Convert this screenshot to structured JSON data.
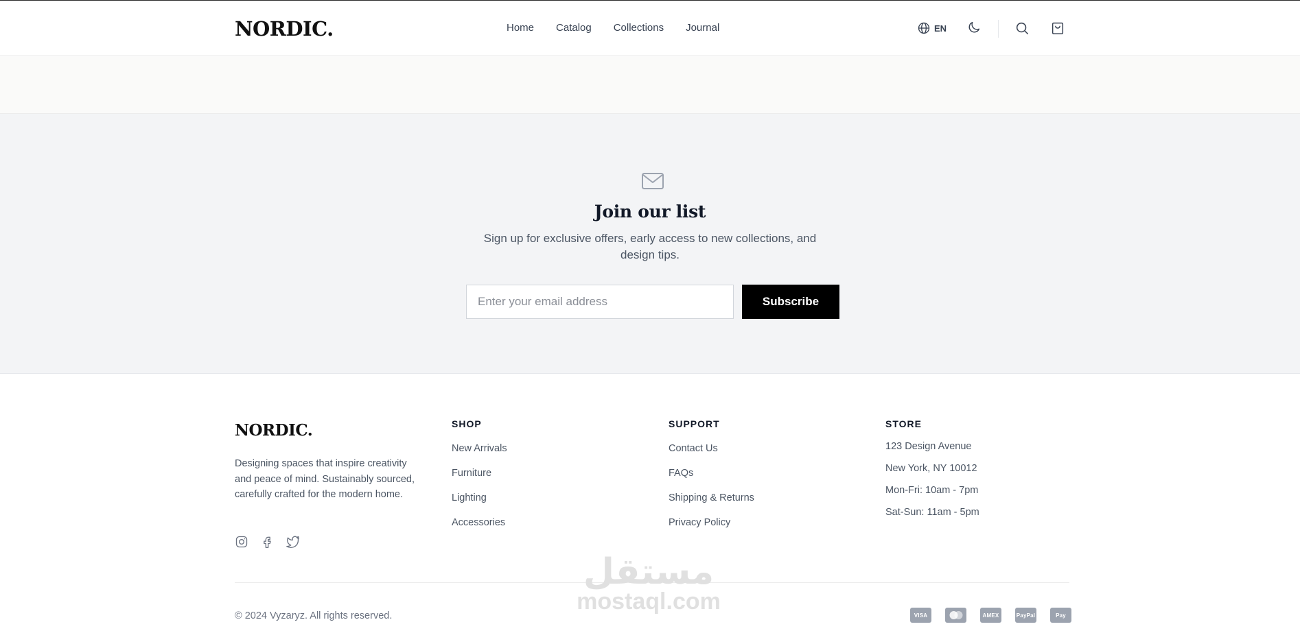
{
  "header": {
    "logo": "NORDIC.",
    "nav": [
      "Home",
      "Catalog",
      "Collections",
      "Journal"
    ],
    "language": "EN",
    "icons": [
      "globe-icon",
      "moon-icon",
      "search-icon",
      "cart-icon"
    ]
  },
  "newsletter": {
    "icon": "mail-icon",
    "title": "Join our list",
    "text": "Sign up for exclusive offers, early access to new collections, and design tips.",
    "email_placeholder": "Enter your email address",
    "email_value": "",
    "button": "Subscribe"
  },
  "footer": {
    "logo": "NORDIC.",
    "description": "Designing spaces that inspire creativity and peace of mind. Sustainably sourced, carefully crafted for the modern home.",
    "socials": [
      "instagram-icon",
      "facebook-icon",
      "twitter-icon"
    ],
    "shop": {
      "heading": "SHOP",
      "links": [
        "New Arrivals",
        "Furniture",
        "Lighting",
        "Accessories"
      ]
    },
    "support": {
      "heading": "SUPPORT",
      "links": [
        "Contact Us",
        "FAQs",
        "Shipping & Returns",
        "Privacy Policy"
      ]
    },
    "store": {
      "heading": "STORE",
      "lines": [
        "123 Design Avenue",
        "New York, NY 10012",
        "Mon-Fri: 10am - 7pm",
        "Sat-Sun: 11am - 5pm"
      ]
    },
    "copyright": "© 2024 Vyzaryz. All rights reserved.",
    "payments": [
      "VISA",
      "MC",
      "AMEX",
      "PayPal",
      "Pay"
    ]
  },
  "watermark": {
    "arabic": "مستقل",
    "latin": "mostaql.com"
  },
  "colors": {
    "accent": "#000000",
    "widget": "#2f2f2f",
    "widget_star": "#e4f000",
    "newsletter_bg": "#f3f4f6"
  }
}
